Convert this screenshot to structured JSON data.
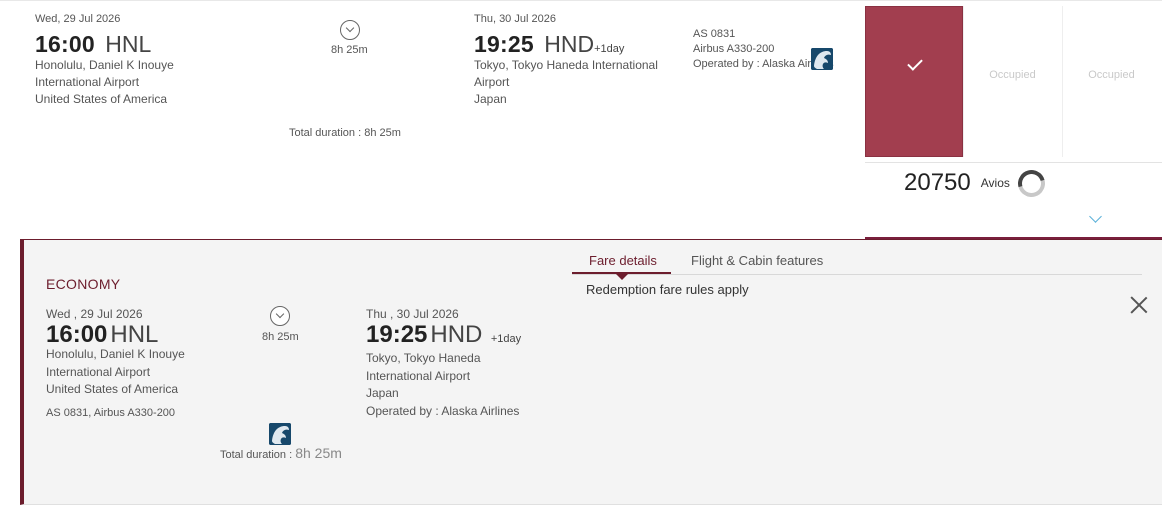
{
  "flight": {
    "departure": {
      "date": "Wed, 29 Jul 2026",
      "time": "16:00",
      "code": "HNL",
      "place_lines": [
        "Honolulu, Daniel K Inouye",
        "International Airport",
        "United States of America"
      ]
    },
    "duration_short": "8h 25m",
    "total_duration": "Total duration : 8h 25m",
    "arrival": {
      "date": "Thu, 30 Jul 2026",
      "time": "19:25",
      "code": "HND",
      "plus_day": "+1day",
      "place_lines": [
        "Tokyo, Tokyo Haneda International",
        "Airport",
        "Japan"
      ]
    },
    "flight_number": "AS 0831",
    "aircraft": "Airbus A330-200",
    "operated_by": "Operated by : Alaska Airlines",
    "airline_icon": "alaska-airlines-logo-icon"
  },
  "fares": {
    "cells": [
      {
        "state": "selected",
        "icon": "check-icon"
      },
      {
        "state": "occupied",
        "label": "Occupied"
      },
      {
        "state": "occupied",
        "label": "Occupied"
      }
    ],
    "avios_amount": "20750",
    "avios_label": "Avios",
    "selected_color": "#a23e4f"
  },
  "details": {
    "cabin": "ECONOMY",
    "departure": {
      "date": "Wed , 29 Jul 2026",
      "time": "16:00",
      "code": "HNL",
      "place_lines": [
        "Honolulu, Daniel K Inouye",
        "International Airport",
        "United States of America"
      ]
    },
    "duration": "8h 25m",
    "arrival": {
      "date": "Thu , 30 Jul 2026",
      "time": "19:25",
      "code": "HND",
      "plus_day": "+1day",
      "place_lines": [
        "Tokyo, Tokyo Haneda",
        "International Airport",
        "Japan"
      ]
    },
    "operated_by": "Operated by : Alaska Airlines",
    "flight_info": "AS 0831, Airbus A330-200",
    "total_duration_label": "Total duration : ",
    "total_duration_value": "8h 25m",
    "tabs": [
      {
        "label": "Fare details",
        "active": true
      },
      {
        "label": "Flight & Cabin features",
        "active": false
      }
    ],
    "fare_rules_text": "Redemption fare rules apply",
    "accent_color": "#6c1d2d"
  }
}
